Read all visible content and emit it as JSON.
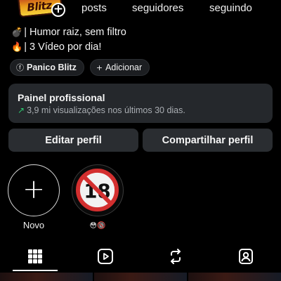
{
  "header": {
    "avatar_logo_text": "Blitz",
    "stats": [
      {
        "label": "posts"
      },
      {
        "label": "seguidores"
      },
      {
        "label": "seguindo"
      }
    ]
  },
  "bio": {
    "line1_emoji": "💣",
    "line1_text": "| Humor raiz, sem filtro",
    "line2_emoji": "🔥",
    "line2_text": "| 3 Vídeo por dia!"
  },
  "chips": {
    "profile_icon": "ⓕ",
    "profile_label": "Panico Blitz",
    "add_icon": "+",
    "add_label": "Adicionar"
  },
  "panel": {
    "title": "Painel profissional",
    "arrow": "↗",
    "subtitle": "3,9 mi visualizações nos últimos 30 dias."
  },
  "buttons": {
    "edit": "Editar perfil",
    "share": "Compartilhar perfil"
  },
  "highlights": [
    {
      "label": "Novo",
      "icon": "plus-icon"
    },
    {
      "label": "😳🔞",
      "icon": "no-under-18-icon"
    }
  ],
  "highlight_plus": "+",
  "highlight_18_number": "18",
  "tabs": [
    {
      "icon": "grid-icon",
      "selected": true
    },
    {
      "icon": "reels-icon",
      "selected": false
    },
    {
      "icon": "reposts-icon",
      "selected": false
    },
    {
      "icon": "tagged-icon",
      "selected": false
    }
  ],
  "colors": {
    "background": "#000000",
    "panel": "#25282c",
    "button": "#2a2d31",
    "accent_green": "#2ecc71",
    "no_sign_red": "#d32f2f"
  }
}
